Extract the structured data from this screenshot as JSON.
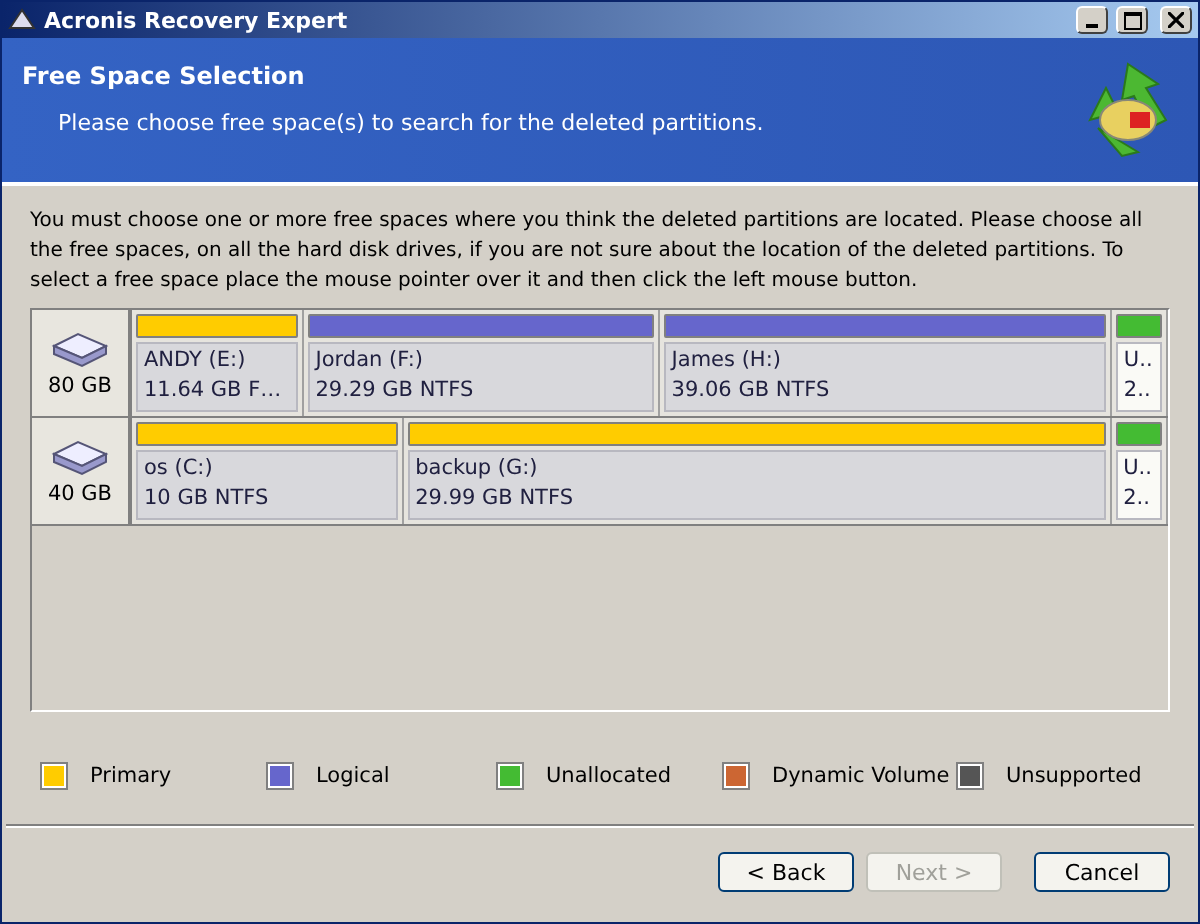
{
  "window": {
    "title": "Acronis Recovery Expert"
  },
  "header": {
    "title": "Free Space Selection",
    "subtitle": "Please choose free space(s) to search for the deleted partitions."
  },
  "instructions": "You must choose one or more free spaces where you think the deleted partitions are located. Please choose all the free spaces, on all the hard disk drives, if you are not sure about the location of the deleted partitions. To select a free space place the mouse pointer over it and then click the left mouse button.",
  "disks": [
    {
      "size": "80 GB",
      "partitions": [
        {
          "kind": "primary",
          "color": "#ffcc00",
          "name": "ANDY (E:)",
          "detail": "11.64 GB  F…"
        },
        {
          "kind": "logical",
          "color": "#6666cc",
          "name": "Jordan (F:)",
          "detail": "29.29 GB  NTFS"
        },
        {
          "kind": "logical",
          "color": "#6666cc",
          "name": "James (H:)",
          "detail": "39.06 GB  NTFS"
        },
        {
          "kind": "unallocated",
          "color": "#44bb33",
          "name": "U..",
          "detail": "2.."
        }
      ]
    },
    {
      "size": "40 GB",
      "partitions": [
        {
          "kind": "primary",
          "color": "#ffcc00",
          "name": "os (C:)",
          "detail": "10 GB  NTFS"
        },
        {
          "kind": "primary",
          "color": "#ffcc00",
          "name": "backup (G:)",
          "detail": "29.99 GB  NTFS"
        },
        {
          "kind": "unallocated",
          "color": "#44bb33",
          "name": "U..",
          "detail": "2.."
        }
      ]
    }
  ],
  "legend": [
    {
      "label": "Primary",
      "color": "#ffcc00"
    },
    {
      "label": "Logical",
      "color": "#6666cc"
    },
    {
      "label": "Unallocated",
      "color": "#44bb33"
    },
    {
      "label": "Dynamic Volume",
      "color": "#cc6633"
    },
    {
      "label": "Unsupported",
      "color": "#555555"
    }
  ],
  "buttons": [
    {
      "label": "< Back",
      "disabled": false
    },
    {
      "label": "Next >",
      "disabled": true
    },
    {
      "label": "Cancel",
      "disabled": false
    }
  ]
}
